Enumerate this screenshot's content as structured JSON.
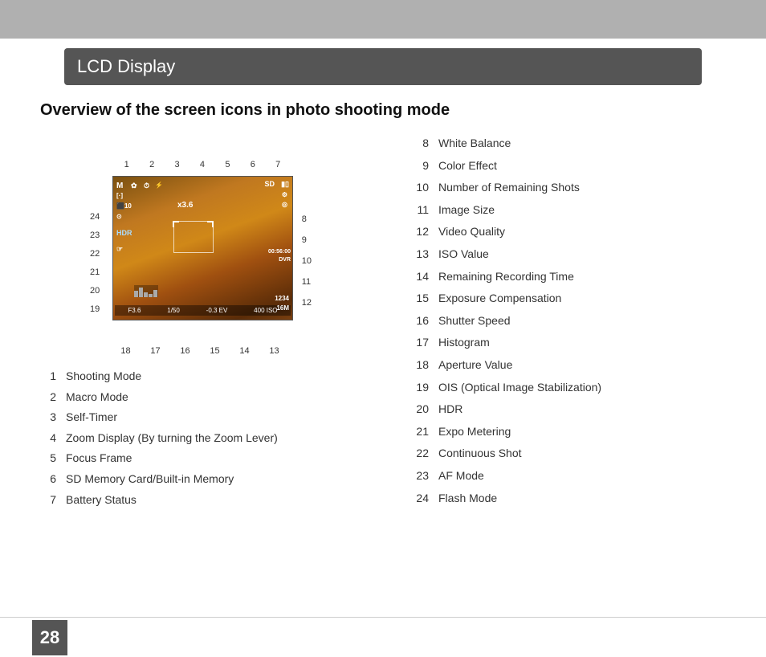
{
  "topBar": {},
  "sectionHeader": {
    "label": "LCD Display"
  },
  "pageTitle": "Overview of the screen icons in photo shooting mode",
  "leftList": [
    {
      "num": "1",
      "text": "Shooting Mode"
    },
    {
      "num": "2",
      "text": "Macro Mode"
    },
    {
      "num": "3",
      "text": "Self-Timer"
    },
    {
      "num": "4",
      "text": "Zoom Display (By turning the Zoom Lever)"
    },
    {
      "num": "5",
      "text": "Focus Frame"
    },
    {
      "num": "6",
      "text": "SD Memory Card/Built-in Memory"
    },
    {
      "num": "7",
      "text": "Battery Status"
    }
  ],
  "rightList": [
    {
      "num": "8",
      "text": "White Balance"
    },
    {
      "num": "9",
      "text": "Color Effect"
    },
    {
      "num": "10",
      "text": "Number of Remaining Shots"
    },
    {
      "num": "11",
      "text": "Image Size"
    },
    {
      "num": "12",
      "text": "Video Quality"
    },
    {
      "num": "13",
      "text": "ISO Value"
    },
    {
      "num": "14",
      "text": "Remaining Recording Time"
    },
    {
      "num": "15",
      "text": "Exposure Compensation"
    },
    {
      "num": "16",
      "text": "Shutter Speed"
    },
    {
      "num": "17",
      "text": "Histogram"
    },
    {
      "num": "18",
      "text": "Aperture Value"
    },
    {
      "num": "19",
      "text": "OIS (Optical Image Stabilization)"
    },
    {
      "num": "20",
      "text": "HDR"
    },
    {
      "num": "21",
      "text": "Expo Metering"
    },
    {
      "num": "22",
      "text": "Continuous Shot"
    },
    {
      "num": "23",
      "text": "AF Mode"
    },
    {
      "num": "24",
      "text": "Flash Mode"
    }
  ],
  "topNums": [
    "1",
    "2",
    "3",
    "4",
    "5",
    "6",
    "7"
  ],
  "leftNums": [
    "24",
    "23",
    "22",
    "21",
    "20",
    "19"
  ],
  "rightNums": [
    "8",
    "9",
    "10",
    "11",
    "12"
  ],
  "bottomNums": [
    "18",
    "17",
    "16",
    "15",
    "14",
    "13"
  ],
  "pageNumber": "28"
}
